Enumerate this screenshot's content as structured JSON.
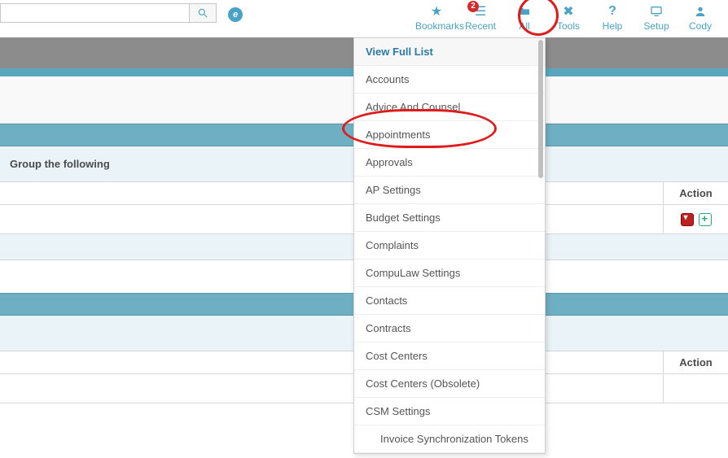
{
  "search": {
    "placeholder": ""
  },
  "nav": {
    "bookmarks": "Bookmarks",
    "recent": "Recent",
    "recent_badge": "2",
    "all": "All",
    "tools": "Tools",
    "help": "Help",
    "setup": "Setup",
    "user": "Cody"
  },
  "dropdown": {
    "header": "View Full List",
    "items": [
      "Accounts",
      "Advice And Counsel",
      "Appointments",
      "Approvals",
      "AP Settings",
      "Budget Settings",
      "Complaints",
      "CompuLaw Settings",
      "Contacts",
      "Contracts",
      "Cost Centers",
      "Cost Centers (Obsolete)",
      "CSM Settings"
    ],
    "sub_item": "Invoice Synchronization Tokens"
  },
  "section1": {
    "group_label": "Group the following",
    "action_header": "Action"
  },
  "section2": {
    "action_header": "Action"
  }
}
